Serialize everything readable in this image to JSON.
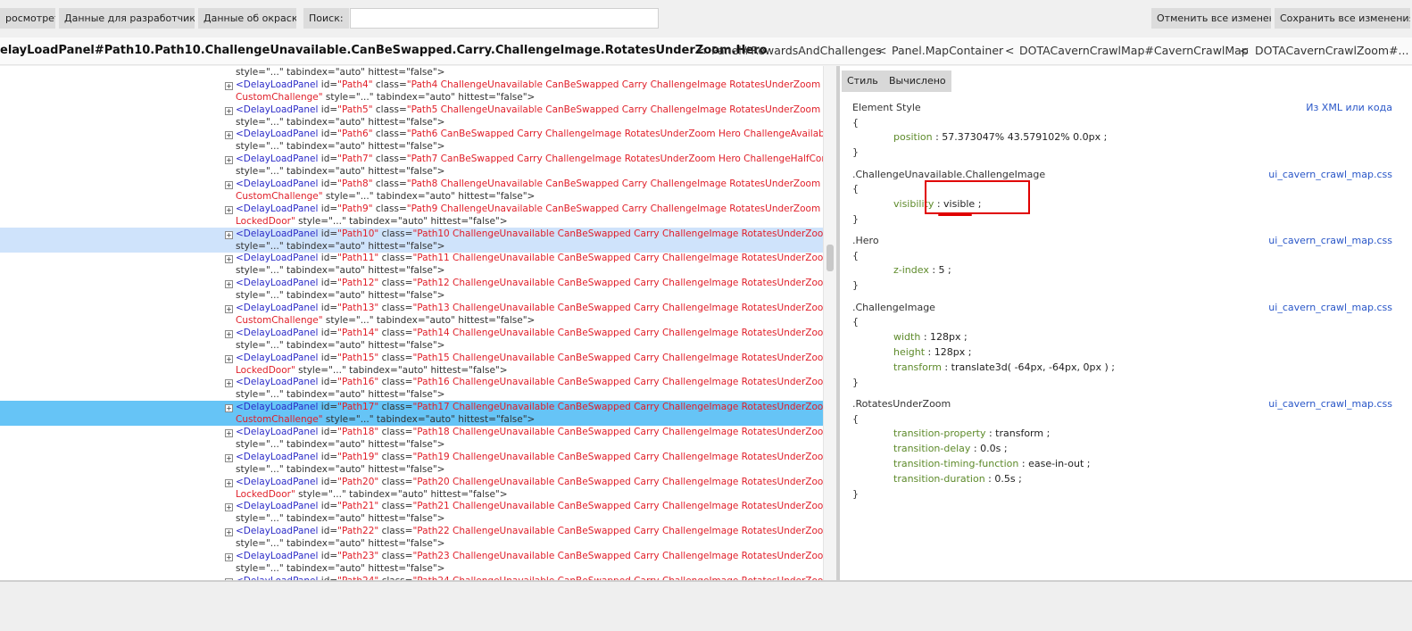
{
  "toolbar": {
    "view_label": "росмотреть",
    "dev_data_label": "Данные для разработчиков",
    "paint_data_label": "Данные об окраске",
    "search_label": "Поиск:",
    "search_value": "",
    "revert_label": "Отменить все изменения",
    "save_label": "Сохранить все изменения"
  },
  "breadcrumb": {
    "current": "elayLoadPanel#Path10.Path10.ChallengeUnavailable.CanBeSwapped.Carry.ChallengeImage.RotatesUnderZoom.Hero",
    "sep": "<",
    "items": [
      "Panel#RewardsAndChallenges",
      "Panel.MapContainer",
      "DOTACavernCrawlMap#CavernCrawlMap",
      "DOTACavernCrawlZoom#..."
    ]
  },
  "tree": {
    "rows": [
      {
        "tag": "",
        "attrs": "",
        "cls": "",
        "line2_val": "",
        "line2_rest": "style=\"...\" tabindex=\"auto\" hittest=\"false\">",
        "partial_top": true
      },
      {
        "tag": "<DelayLoadPanel",
        "id": "\"Path4\"",
        "cls": "\"Path4 ChallengeUnavailable CanBeSwapped Carry ChallengeImage RotatesUnderZoom",
        "line2_val": "CustomChallenge\"",
        "line2_rest": " style=\"...\" tabindex=\"auto\" hittest=\"false\">"
      },
      {
        "tag": "<DelayLoadPanel",
        "id": "\"Path5\"",
        "cls": "\"Path5 ChallengeUnavailable CanBeSwapped Carry ChallengeImage RotatesUnderZoom CaveIn\"",
        "line2_val": "",
        "line2_rest": "style=\"...\" tabindex=\"auto\" hittest=\"false\">"
      },
      {
        "tag": "<DelayLoadPanel",
        "id": "\"Path6\"",
        "cls": "\"Path6 CanBeSwapped Carry ChallengeImage RotatesUnderZoom Hero ChallengeAvailable\"",
        "line2_val": "",
        "line2_rest": "style=\"...\" tabindex=\"auto\" hittest=\"false\">"
      },
      {
        "tag": "<DelayLoadPanel",
        "id": "\"Path7\"",
        "cls": "\"Path7 CanBeSwapped Carry ChallengeImage RotatesUnderZoom Hero ChallengeHalfCompleted\"",
        "line2_val": "",
        "line2_rest": "style=\"...\" tabindex=\"auto\" hittest=\"false\">"
      },
      {
        "tag": "<DelayLoadPanel",
        "id": "\"Path8\"",
        "cls": "\"Path8 ChallengeUnavailable CanBeSwapped Carry ChallengeImage RotatesUnderZoom",
        "line2_val": "CustomChallenge\"",
        "line2_rest": " style=\"...\" tabindex=\"auto\" hittest=\"false\">"
      },
      {
        "tag": "<DelayLoadPanel",
        "id": "\"Path9\"",
        "cls": "\"Path9 ChallengeUnavailable CanBeSwapped Carry ChallengeImage RotatesUnderZoom",
        "line2_val": "LockedDoor\"",
        "line2_rest": " style=\"...\" tabindex=\"auto\" hittest=\"false\">"
      },
      {
        "tag": "<DelayLoadPanel",
        "id": "\"Path10\"",
        "cls": "\"Path10 ChallengeUnavailable CanBeSwapped Carry ChallengeImage RotatesUnderZoom Hero\"",
        "line2_val": "",
        "line2_rest": "style=\"...\" tabindex=\"auto\" hittest=\"false\">",
        "state": "sel"
      },
      {
        "tag": "<DelayLoadPanel",
        "id": "\"Path11\"",
        "cls": "\"Path11 ChallengeUnavailable CanBeSwapped Carry ChallengeImage RotatesUnderZoom Hero\"",
        "line2_val": "",
        "line2_rest": "style=\"...\" tabindex=\"auto\" hittest=\"false\">"
      },
      {
        "tag": "<DelayLoadPanel",
        "id": "\"Path12\"",
        "cls": "\"Path12 ChallengeUnavailable CanBeSwapped Carry ChallengeImage RotatesUnderZoom Hero\"",
        "line2_val": "",
        "line2_rest": "style=\"...\" tabindex=\"auto\" hittest=\"false\">"
      },
      {
        "tag": "<DelayLoadPanel",
        "id": "\"Path13\"",
        "cls": "\"Path13 ChallengeUnavailable CanBeSwapped Carry ChallengeImage RotatesUnderZoom",
        "line2_val": "CustomChallenge\"",
        "line2_rest": " style=\"...\" tabindex=\"auto\" hittest=\"false\">"
      },
      {
        "tag": "<DelayLoadPanel",
        "id": "\"Path14\"",
        "cls": "\"Path14 ChallengeUnavailable CanBeSwapped Carry ChallengeImage RotatesUnderZoom Hero\"",
        "line2_val": "",
        "line2_rest": "style=\"...\" tabindex=\"auto\" hittest=\"false\">"
      },
      {
        "tag": "<DelayLoadPanel",
        "id": "\"Path15\"",
        "cls": "\"Path15 ChallengeUnavailable CanBeSwapped Carry ChallengeImage RotatesUnderZoom",
        "line2_val": "LockedDoor\"",
        "line2_rest": " style=\"...\" tabindex=\"auto\" hittest=\"false\">"
      },
      {
        "tag": "<DelayLoadPanel",
        "id": "\"Path16\"",
        "cls": "\"Path16 ChallengeUnavailable CanBeSwapped Carry ChallengeImage RotatesUnderZoom Hero\"",
        "line2_val": "",
        "line2_rest": "style=\"...\" tabindex=\"auto\" hittest=\"false\">"
      },
      {
        "tag": "<DelayLoadPanel",
        "id": "\"Path17\"",
        "cls": "\"Path17 ChallengeUnavailable CanBeSwapped Carry ChallengeImage RotatesUnderZoom",
        "line2_val": "CustomChallenge\"",
        "line2_rest": " style=\"...\" tabindex=\"auto\" hittest=\"false\">",
        "state": "hl"
      },
      {
        "tag": "<DelayLoadPanel",
        "id": "\"Path18\"",
        "cls": "\"Path18 ChallengeUnavailable CanBeSwapped Carry ChallengeImage RotatesUnderZoom Hero\"",
        "line2_val": "",
        "line2_rest": "style=\"...\" tabindex=\"auto\" hittest=\"false\">"
      },
      {
        "tag": "<DelayLoadPanel",
        "id": "\"Path19\"",
        "cls": "\"Path19 ChallengeUnavailable CanBeSwapped Carry ChallengeImage RotatesUnderZoom CaveIn\"",
        "line2_val": "",
        "line2_rest": "style=\"...\" tabindex=\"auto\" hittest=\"false\">"
      },
      {
        "tag": "<DelayLoadPanel",
        "id": "\"Path20\"",
        "cls": "\"Path20 ChallengeUnavailable CanBeSwapped Carry ChallengeImage RotatesUnderZoom",
        "line2_val": "LockedDoor\"",
        "line2_rest": " style=\"...\" tabindex=\"auto\" hittest=\"false\">"
      },
      {
        "tag": "<DelayLoadPanel",
        "id": "\"Path21\"",
        "cls": "\"Path21 ChallengeUnavailable CanBeSwapped Carry ChallengeImage RotatesUnderZoom Hero\"",
        "line2_val": "",
        "line2_rest": "style=\"...\" tabindex=\"auto\" hittest=\"false\">"
      },
      {
        "tag": "<DelayLoadPanel",
        "id": "\"Path22\"",
        "cls": "\"Path22 ChallengeUnavailable CanBeSwapped Carry ChallengeImage RotatesUnderZoom Hero\"",
        "line2_val": "",
        "line2_rest": "style=\"...\" tabindex=\"auto\" hittest=\"false\">"
      },
      {
        "tag": "<DelayLoadPanel",
        "id": "\"Path23\"",
        "cls": "\"Path23 ChallengeUnavailable CanBeSwapped Carry ChallengeImage RotatesUnderZoom Hero\"",
        "line2_val": "",
        "line2_rest": "style=\"...\" tabindex=\"auto\" hittest=\"false\">"
      },
      {
        "tag": "<DelayLoadPanel",
        "id": "\"Path24\"",
        "cls": "\"Path24 ChallengeUnavailable CanBeSwapped Carry ChallengeImage RotatesUnderZoom CaveIn\"",
        "line2_val": "",
        "line2_rest": ""
      }
    ],
    "attr_id": " id=",
    "attr_class": " class="
  },
  "style_panel": {
    "tabs": [
      "Стиль",
      "Вычислено"
    ],
    "rules": [
      {
        "selector": "Element Style",
        "source": "Из XML или кода",
        "props": [
          {
            "name": "position",
            "value": "57.373047% 43.579102% 0.0px"
          }
        ]
      },
      {
        "selector": ".ChallengeUnavailable.ChallengeImage",
        "source": "ui_cavern_crawl_map.css",
        "props": [
          {
            "name": "visibility",
            "value": "visible"
          }
        ]
      },
      {
        "selector": ".Hero",
        "source": "ui_cavern_crawl_map.css",
        "props": [
          {
            "name": "z-index",
            "value": "5"
          }
        ]
      },
      {
        "selector": ".ChallengeImage",
        "source": "ui_cavern_crawl_map.css",
        "props": [
          {
            "name": "width",
            "value": "128px"
          },
          {
            "name": "height",
            "value": "128px"
          },
          {
            "name": "transform",
            "value": "translate3d( -64px, -64px, 0px )"
          }
        ]
      },
      {
        "selector": ".RotatesUnderZoom",
        "source": "ui_cavern_crawl_map.css",
        "props": [
          {
            "name": "transition-property",
            "value": "transform"
          },
          {
            "name": "transition-delay",
            "value": "0.0s"
          },
          {
            "name": "transition-timing-function",
            "value": "ease-in-out"
          },
          {
            "name": "transition-duration",
            "value": "0.5s"
          }
        ]
      }
    ],
    "open_brace": "{",
    "close_brace": "}",
    "colon": " : ",
    "semicolon": " ;"
  },
  "colors": {
    "tag": "#2c2cc8",
    "value": "#e0202a",
    "prop_name": "#5d8a2a",
    "source_link": "#2a57c8",
    "selected_row": "#cfe3fb",
    "highlighted_row": "#66c4f6",
    "annotation": "#e00000"
  },
  "icons": {
    "expand": "plus-box-icon"
  }
}
